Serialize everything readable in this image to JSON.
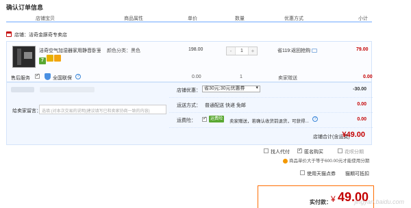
{
  "page_title": "确认订单信息",
  "columns": [
    "店铺宝贝",
    "商品属性",
    "单价",
    "数量",
    "优惠方式",
    "小计"
  ],
  "store": {
    "label": "店铺：",
    "name": "洁奇金豚奇专卖店"
  },
  "item": {
    "name": "洁奇空气加湿器家用静音卧室大...",
    "spec": "颜色分类：黑色",
    "price": "198.00",
    "quantity": "1",
    "qty_minus": "-",
    "qty_plus": "+",
    "promo": "省119:返回抢购",
    "subtotal": "79.00",
    "badges": [
      "7",
      "",
      ""
    ]
  },
  "service": {
    "label": "售后服务",
    "name": "全国联保",
    "price": "0.00",
    "qty": "1",
    "shipping": "卖家赠送",
    "subtotal": "0.00"
  },
  "message": {
    "label": "给卖家留言：",
    "placeholder": "选填:(对本次交易的说明(建议填写已和卖家协商一致的内容)"
  },
  "store_coupon": {
    "label": "店铺优惠：",
    "selected": "省30元:30元优惠券",
    "value": "-30.00"
  },
  "shipping": {
    "label": "运送方式：",
    "text": "普通配送 快递 免邮",
    "value": "0.00"
  },
  "insurance": {
    "label": "运费险：",
    "tag": "运费险",
    "text": "卖家赠送，若确认收货前退货，可获得...",
    "value": "0.00"
  },
  "store_total": {
    "label": "店铺合计(含运费)",
    "value": "¥49.00"
  },
  "options": {
    "proxy_pay": "找人代付",
    "anonymous": "匿名购买",
    "installment": "花呗分期",
    "installment_note": "商品单价大于等于600.00元才能使用分期",
    "tmall_points": "使用天猫点券",
    "points_note": "猫期可抵扣"
  },
  "payment": {
    "label": "实付款：",
    "currency": "¥",
    "value": "49.00"
  },
  "watermark": "jingyan.baidu.com",
  "icons": [
    "shop-icon",
    "help-icon",
    "shield-icon",
    "promo-icon",
    "warn-icon",
    "checkbox-icon"
  ]
}
